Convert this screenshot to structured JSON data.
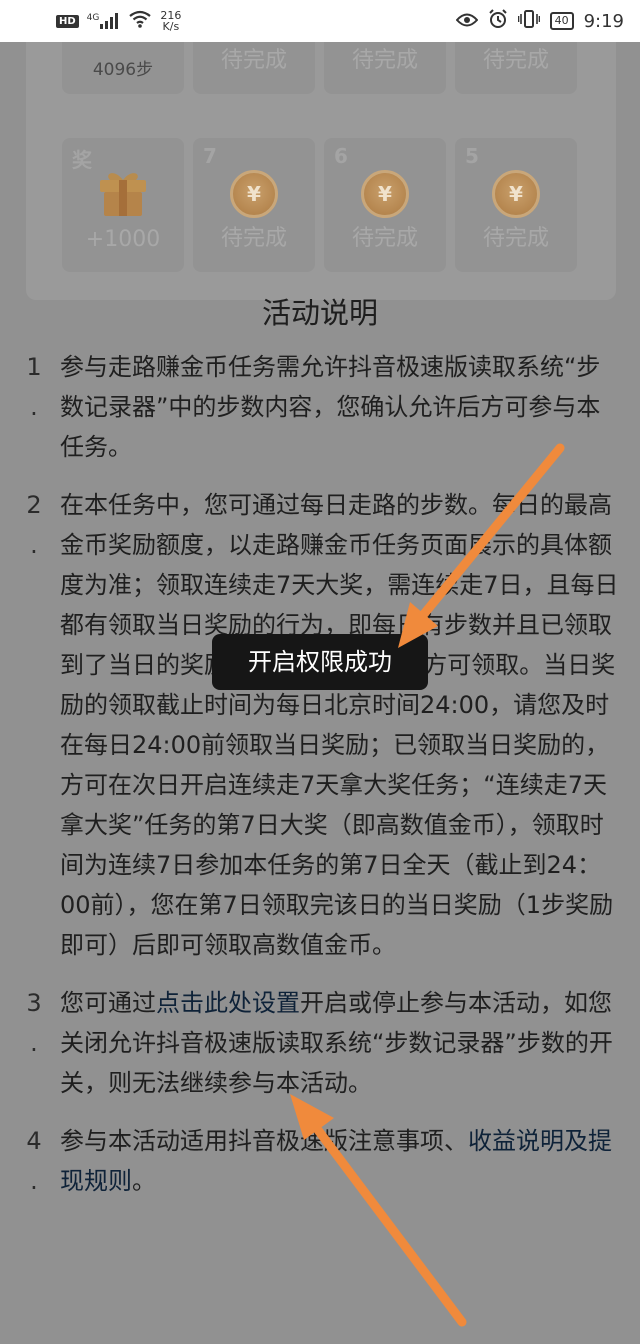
{
  "status_bar": {
    "hd": "HD",
    "signal": "4G",
    "speed_value": "216",
    "speed_unit": "K/s",
    "battery": "40",
    "time": "9:19"
  },
  "progress_card": {
    "top_row": [
      {
        "label": "4096步"
      },
      {
        "label": "待完成"
      },
      {
        "label": "待完成"
      },
      {
        "label": "待完成"
      }
    ],
    "bottom_row": [
      {
        "day": "奖",
        "label": "+1000",
        "icon": "gift-icon"
      },
      {
        "day": "7",
        "label": "待完成",
        "icon": "coin-icon"
      },
      {
        "day": "6",
        "label": "待完成",
        "icon": "coin-icon"
      },
      {
        "day": "5",
        "label": "待完成",
        "icon": "coin-icon"
      }
    ],
    "coin_symbol": "¥"
  },
  "rules": {
    "title": "活动说明",
    "items": [
      {
        "idx": "1",
        "text": "参与走路赚金币任务需允许抖音极速版读取系统“步数记录器”中的步数内容，您确认允许后方可参与本任务。"
      },
      {
        "idx": "2",
        "text": "在本任务中，您可通过每日走路的步数。每日的最高金币奖励额度，以走路赚金币任务页面展示的具体额度为准；领取连续走7天大奖，需连续走7日，且每日都有领取当日奖励的行为，即每日有步数并且已领取到了当日的奖励（1步奖励即可），方可领取。当日奖励的领取截止时间为每日北京时间24:00，请您及时在每日24:00前领取当日奖励；已领取当日奖励的，方可在次日开启连续走7天拿大奖任务；“连续走7天拿大奖”任务的第7日大奖（即高数值金币），领取时间为连续7日参加本任务的第7日全天（截止到24：00前），您在第7日领取完该日的当日奖励（1步奖励即可）后即可领取高数值金币。"
      },
      {
        "idx": "3",
        "text_before": "您可通过",
        "link": "点击此处设置",
        "text_after": "开启或停止参与本活动，如您关闭允许抖音极速版读取系统“步数记录器”步数的开关，则无法继续参与本活动。"
      },
      {
        "idx": "4",
        "text_before": "参与本活动适用抖音极速版注意事项、",
        "link": "收益说明及提现规则",
        "text_after": "。"
      }
    ]
  },
  "toast": {
    "text": "开启权限成功"
  },
  "colors": {
    "arrow": "#f08a3c",
    "toast_bg": "#161616",
    "link": "#0e2238"
  }
}
